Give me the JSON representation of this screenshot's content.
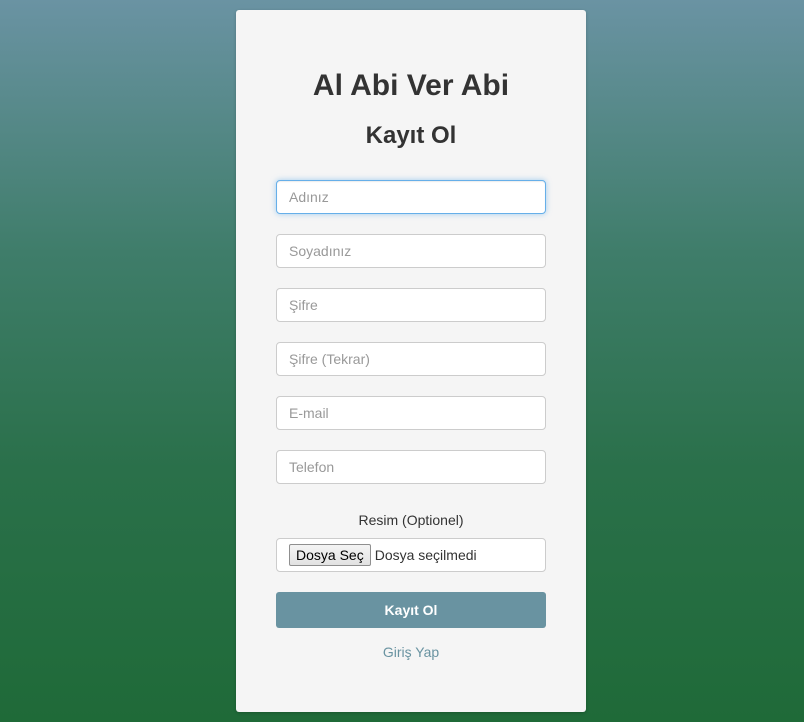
{
  "app": {
    "title": "Al Abi Ver Abi",
    "subtitle": "Kayıt Ol"
  },
  "form": {
    "fields": [
      {
        "name": "first-name",
        "placeholder": "Adınız",
        "value": "",
        "focused": true
      },
      {
        "name": "last-name",
        "placeholder": "Soyadınız",
        "value": ""
      },
      {
        "name": "password",
        "placeholder": "Şifre",
        "value": ""
      },
      {
        "name": "password-confirm",
        "placeholder": "Şifre (Tekrar)",
        "value": ""
      },
      {
        "name": "email",
        "placeholder": "E-mail",
        "value": ""
      },
      {
        "name": "phone",
        "placeholder": "Telefon",
        "value": ""
      }
    ],
    "image_label": "Resim (Optionel)",
    "file_button_label": "Dosya Seç",
    "file_status": "Dosya seçilmedi",
    "submit_label": "Kayıt Ol",
    "login_link": "Giriş Yap"
  },
  "colors": {
    "accent": "#6993a1",
    "card_background": "#f5f5f5",
    "focus_border": "#66afe9"
  }
}
